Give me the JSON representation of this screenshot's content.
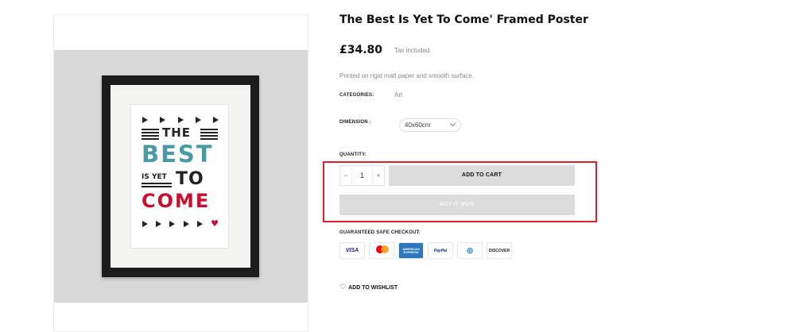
{
  "product": {
    "title": "The Best Is Yet To Come' Framed Poster",
    "price": "£34.80",
    "tax_note": "Tax included",
    "description": "Printed on rigid matt paper and smooth surface.",
    "categories_label": "CATEGORIES:",
    "category_value": "Art",
    "dimension_label": "DIMENSION :",
    "dimension_selected": "40x60cm",
    "quantity_label": "QUANTITY:",
    "quantity_value": "1",
    "quantity_minus": "−",
    "quantity_plus": "+",
    "add_to_cart": "ADD TO CART",
    "buy_it_now": "BUY IT NOW",
    "checkout_label": "GUARANTEED SAFE CHECKOUT:",
    "wishlist": "ADD TO WISHLIST"
  },
  "poster": {
    "line1": "THE",
    "line2": "BEST",
    "line3a": "IS YET",
    "line3b": "TO",
    "line4": "COME"
  },
  "payment_methods": [
    {
      "name": "visa-icon",
      "label": "VISA"
    },
    {
      "name": "mastercard-icon",
      "label": "mastercard"
    },
    {
      "name": "amex-icon",
      "label": "AMERICAN EXPRESS"
    },
    {
      "name": "paypal-icon",
      "label": "PayPal"
    },
    {
      "name": "diners-club-icon",
      "label": "Diners Club International"
    },
    {
      "name": "discover-icon",
      "label": "DISCOVER"
    }
  ],
  "colors": {
    "highlight": "#e0202e",
    "button_bg": "#dcdcdc",
    "poster_teal": "#4a9aa6",
    "poster_red": "#c8102e"
  }
}
